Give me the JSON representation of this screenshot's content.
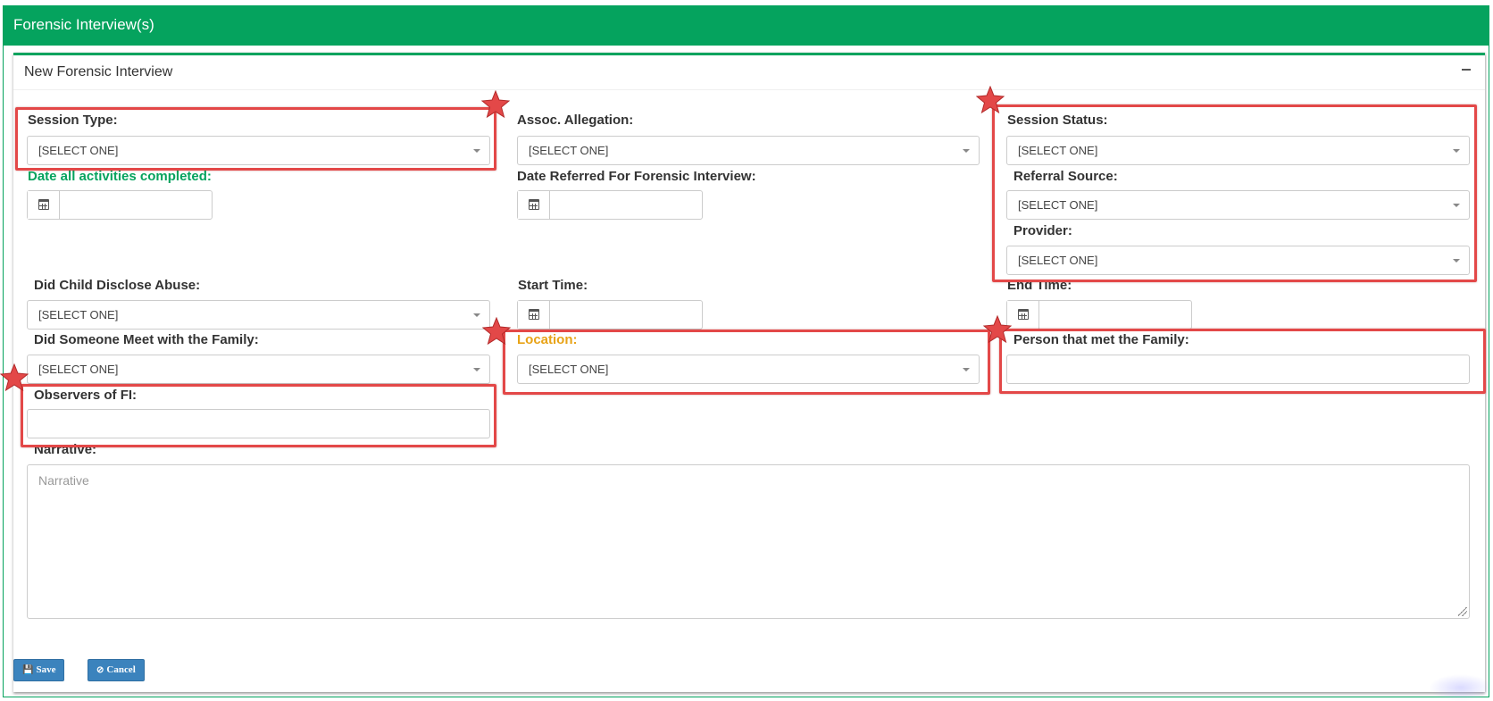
{
  "panel": {
    "title": "Forensic Interview(s)"
  },
  "form": {
    "title": "New Forensic Interview",
    "fields": {
      "session_type": {
        "label": "Session Type:",
        "value": "[SELECT ONE]"
      },
      "assoc_allegation": {
        "label": "Assoc. Allegation:",
        "value": "[SELECT ONE]"
      },
      "session_status": {
        "label": "Session Status:",
        "value": "[SELECT ONE]"
      },
      "date_activities_completed": {
        "label": "Date all activities completed:",
        "value": ""
      },
      "date_referred": {
        "label": "Date Referred For Forensic Interview:",
        "value": ""
      },
      "referral_source": {
        "label": "Referral Source:",
        "value": "[SELECT ONE]"
      },
      "provider": {
        "label": "Provider:",
        "value": "[SELECT ONE]"
      },
      "child_disclose_abuse": {
        "label": "Did Child Disclose Abuse:",
        "value": "[SELECT ONE]"
      },
      "start_time": {
        "label": "Start Time:",
        "value": ""
      },
      "end_time": {
        "label": "End Time:",
        "value": ""
      },
      "someone_met_family": {
        "label": "Did Someone Meet with the Family:",
        "value": "[SELECT ONE]"
      },
      "location": {
        "label": "Location:",
        "value": "[SELECT ONE]"
      },
      "person_met_family": {
        "label": "Person that met the Family:",
        "value": ""
      },
      "observers": {
        "label": "Observers of FI:",
        "value": ""
      },
      "narrative": {
        "label": "Narrative:",
        "placeholder": "Narrative",
        "value": ""
      }
    },
    "buttons": {
      "save": "Save",
      "cancel": "Cancel"
    }
  },
  "icons": {
    "save": "floppy-disk-icon",
    "cancel": "ban-icon",
    "calendar": "calendar-icon",
    "collapse": "minus-icon"
  },
  "colors": {
    "header": "#05a35e",
    "highlight": "#e34848",
    "required_label": "#05a35e",
    "warning_label": "#e8a317",
    "button": "#3b83bd"
  }
}
